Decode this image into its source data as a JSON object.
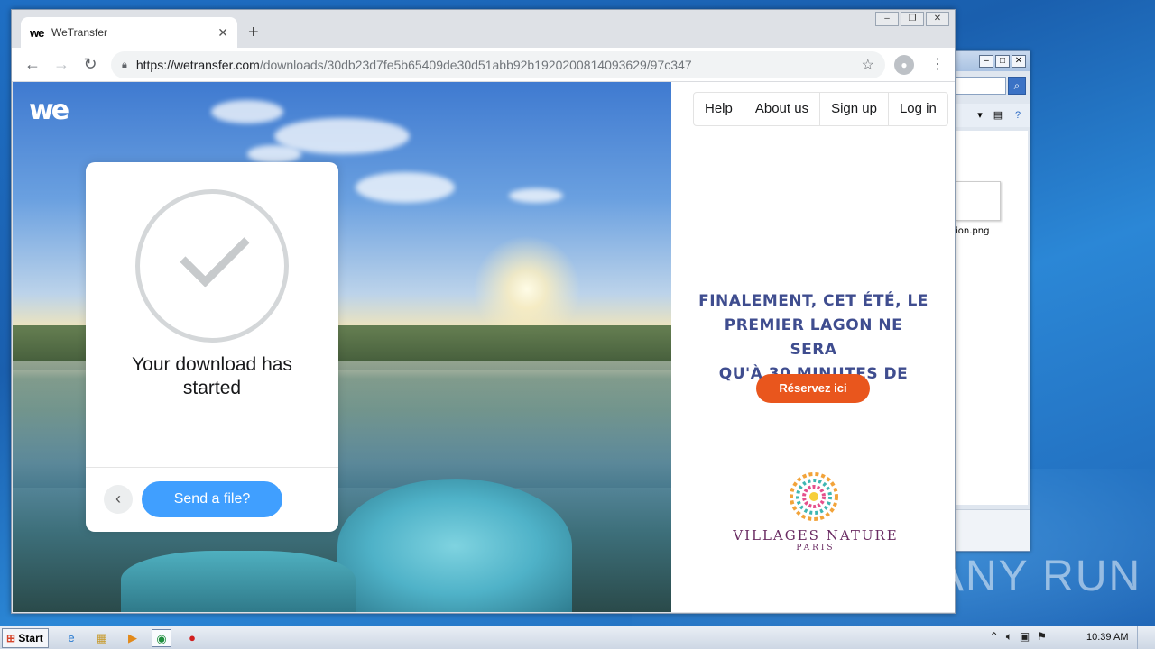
{
  "browser": {
    "tab_title": "WeTransfer",
    "tab_favicon": "we",
    "url_host": "https://wetransfer.com",
    "url_path": "/downloads/30db23d7fe5b65409de30d51abb92b1920200814093629/97c347",
    "window_controls": [
      "–",
      "❐",
      "✕"
    ]
  },
  "page": {
    "logo_text": "we",
    "download_message_line1": "Your download has",
    "download_message_line2": "started",
    "send_button": "Send a file?",
    "nav": [
      "Help",
      "About us",
      "Sign up",
      "Log in"
    ]
  },
  "ad": {
    "headline_1": "FINALEMENT, CET ÉTÉ, LE",
    "headline_2": "PREMIER LAGON NE SERA",
    "headline_3": "QU'À 30 MINUTES DE PARIS",
    "cta": "Réservez ici",
    "brand_name": "VILLAGES NATURE",
    "brand_sub": "PARIS",
    "headline_color": "#3f4d8f",
    "cta_color": "#e9561d",
    "brand_color": "#6a2c63"
  },
  "background_window": {
    "file_label": "ion.png"
  },
  "taskbar": {
    "start_label": "Start",
    "clock": "10:39 AM"
  },
  "watermark": "ANY RUN"
}
